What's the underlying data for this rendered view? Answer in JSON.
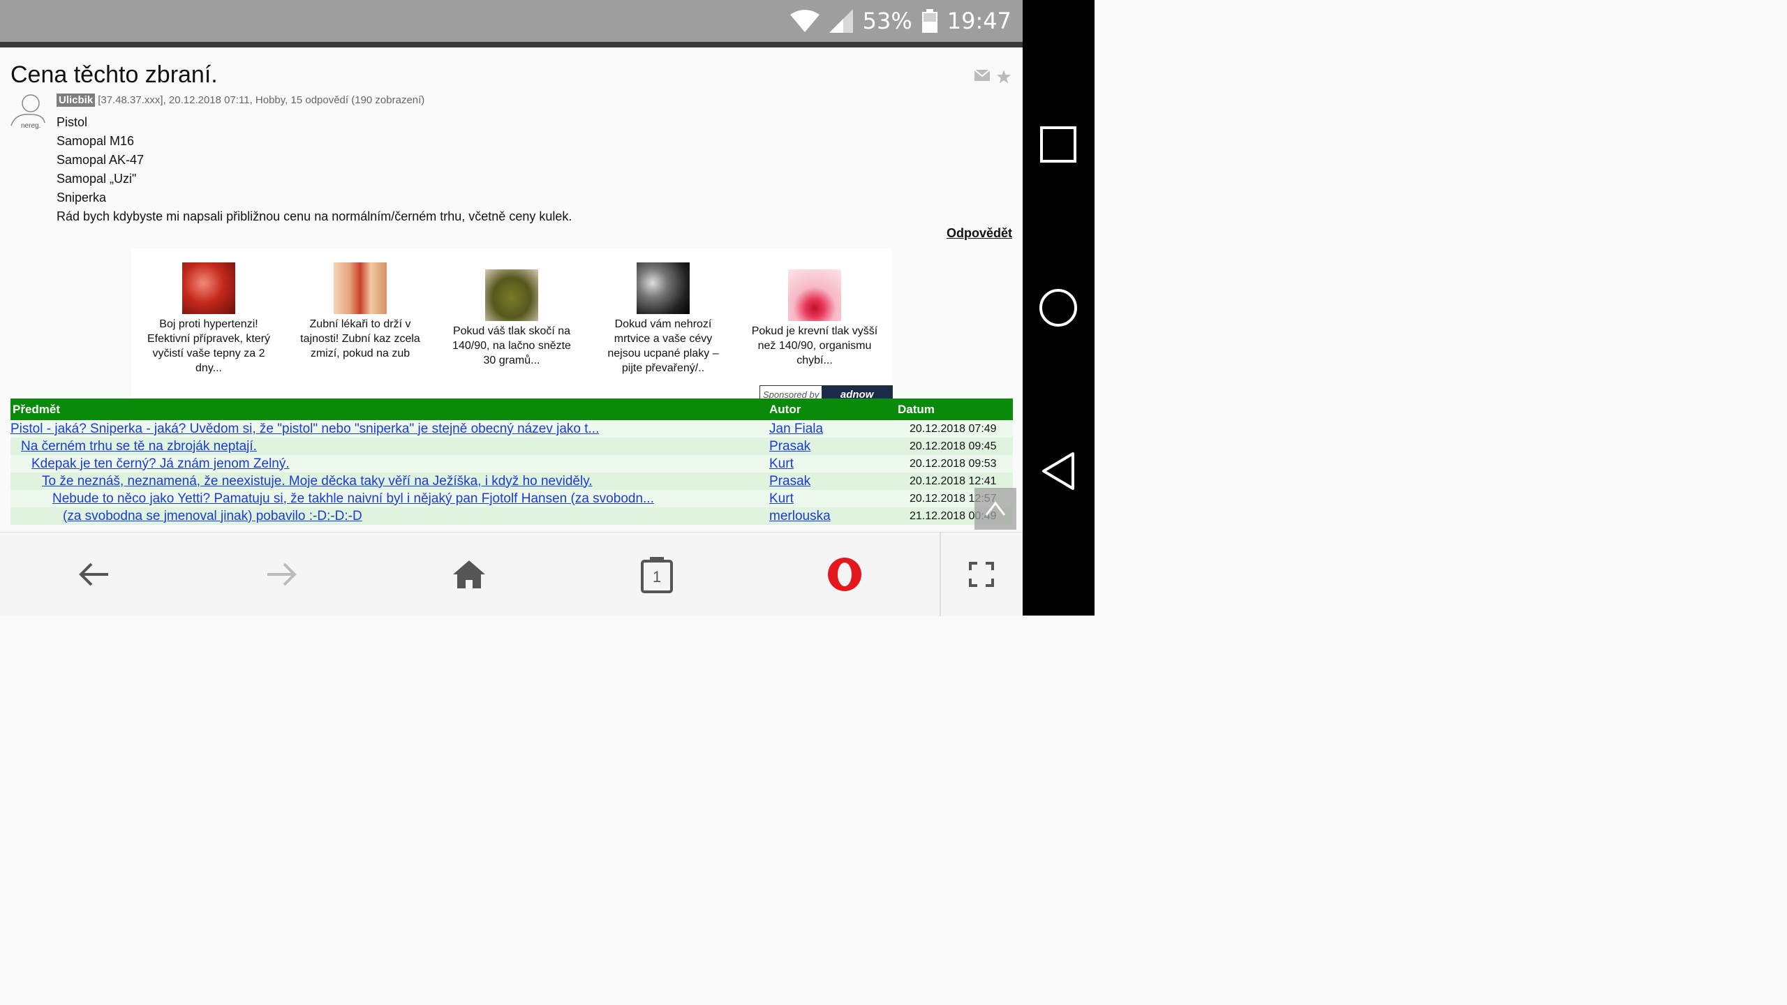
{
  "status_bar": {
    "battery": "53%",
    "time": "19:47"
  },
  "post": {
    "title": "Cena těchto zbraní.",
    "avatar_label": "nereg.",
    "author": "Ulicbik",
    "meta": "[37.48.37.xxx], 20.12.2018 07:11, Hobby, 15 odpovědí (190 zobrazení)",
    "lines": [
      "Pistol",
      "Samopal M16",
      "Samopal AK-47",
      "Samopal „Uzi\"",
      "Sniperka",
      "Rád bych kdybyste mi napsali přibližnou cenu na normálním/černém trhu, včetně ceny kulek."
    ],
    "reply_label": "Odpovědět"
  },
  "ads": {
    "items": [
      {
        "text": "Boj proti hypertenzi! Efektivní přípravek, který vyčistí vaše tepny za 2 dny..."
      },
      {
        "text": "Zubní lékaři to drží v tajnosti! Zubní kaz zcela zmizí, pokud na zub"
      },
      {
        "text": "Pokud váš tlak skočí na 140/90, na lačno snězte 30 gramů..."
      },
      {
        "text": "Dokud vám nehrozí mrtvice a vaše cévy nejsou ucpané plaky – pijte převařený/.."
      },
      {
        "text": "Pokud je krevní tlak vyšší než 140/90, organismu chybí..."
      }
    ],
    "sponsored_by": "Sponsored by",
    "brand": "adnow"
  },
  "thread": {
    "headers": {
      "subject": "Předmět",
      "author": "Autor",
      "date": "Datum"
    },
    "rows": [
      {
        "subject": "Pistol - jaká? Sniperka - jaká? Uvědom si, že \"pistol\" nebo \"sniperka\" je stejně obecný název jako t...",
        "author": "Jan Fiala",
        "date": "20.12.2018 07:49"
      },
      {
        "subject": "Na černém trhu se tě na zbroják neptají.",
        "author": "Prasak",
        "date": "20.12.2018 09:45"
      },
      {
        "subject": "Kdepak je ten černý? Já znám jenom Zelný.",
        "author": "Kurt",
        "date": "20.12.2018 09:53"
      },
      {
        "subject": "To že neznáš, neznamená, že neexistuje. Moje děcka taky věří na Ježíška, i když ho neviděly.",
        "author": "Prasak",
        "date": "20.12.2018 12:41"
      },
      {
        "subject": "Nebude to něco jako Yetti? Pamatuju si, že takhle naivní byl i nějaký pan Fjotolf Hansen (za svobodn...",
        "author": "Kurt",
        "date": "20.12.2018 12:57"
      },
      {
        "subject": "(za svobodna se jmenoval jinak) pobavilo :-D:-D:-D",
        "author": "merlouska",
        "date": "21.12.2018 00:49"
      }
    ]
  },
  "browser": {
    "tab_count": "1"
  }
}
